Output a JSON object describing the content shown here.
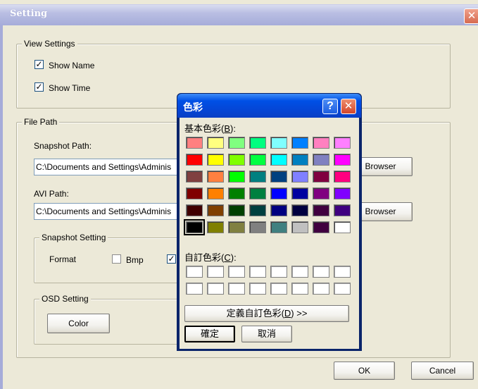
{
  "window": {
    "title": "Setting",
    "close_glyph": "✕"
  },
  "view_settings": {
    "label": "View Settings",
    "show_name": {
      "label": "Show Name",
      "checked": true
    },
    "show_time": {
      "label": "Show Time",
      "checked": true
    }
  },
  "file_path": {
    "label": "File Path",
    "snapshot_label": "Snapshot Path:",
    "snapshot_value": "C:\\Documents and Settings\\Adminis",
    "avi_label": "AVI Path:",
    "avi_value": "C:\\Documents and Settings\\Adminis",
    "browser_label": "Browser"
  },
  "snapshot_setting": {
    "label": "Snapshot Setting",
    "format_label": "Format",
    "bmp_label": "Bmp",
    "bmp_checked": false,
    "second_checked": true
  },
  "osd_setting": {
    "label": "OSD Setting",
    "color_button": "Color"
  },
  "footer": {
    "ok": "OK",
    "cancel": "Cancel"
  },
  "color_dialog": {
    "title": "色彩",
    "help_glyph": "?",
    "close_glyph": "✕",
    "basic_label_pre": "基本色彩(",
    "basic_label_key": "B",
    "basic_label_post": "):",
    "basic_colors": [
      [
        "#ff8080",
        "#ffff80",
        "#80ff80",
        "#00ff80",
        "#80ffff",
        "#0080ff",
        "#ff80c0",
        "#ff80ff"
      ],
      [
        "#ff0000",
        "#ffff00",
        "#80ff00",
        "#00ff40",
        "#00ffff",
        "#0080c0",
        "#8080c0",
        "#ff00ff"
      ],
      [
        "#804040",
        "#ff8040",
        "#00ff00",
        "#008080",
        "#004080",
        "#8080ff",
        "#800040",
        "#ff0080"
      ],
      [
        "#800000",
        "#ff8000",
        "#008000",
        "#008040",
        "#0000ff",
        "#0000a0",
        "#800080",
        "#8000ff"
      ],
      [
        "#400000",
        "#804000",
        "#004000",
        "#004040",
        "#000080",
        "#000040",
        "#400040",
        "#400080"
      ],
      [
        "#000000",
        "#808000",
        "#808040",
        "#808080",
        "#408080",
        "#c0c0c0",
        "#400040",
        "#ffffff"
      ]
    ],
    "selected_color": "#000000",
    "custom_label_pre": "自訂色彩(",
    "custom_label_key": "C",
    "custom_label_post": "):",
    "define_pre": "定義自訂色彩(",
    "define_key": "D",
    "define_post": ") >>",
    "ok": "確定",
    "cancel": "取消"
  }
}
